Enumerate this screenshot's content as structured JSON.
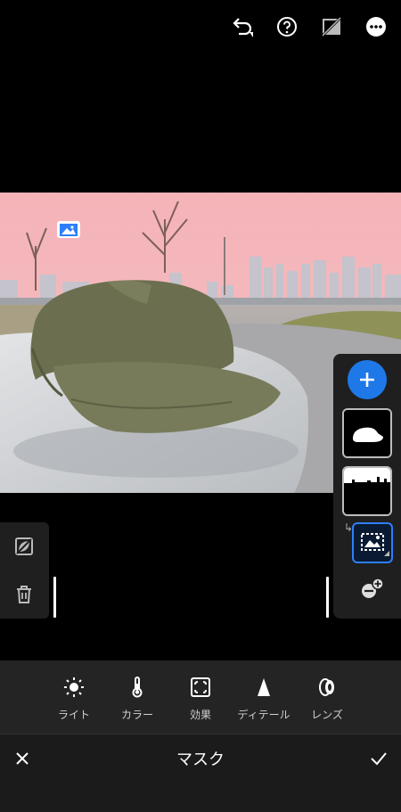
{
  "top_bar": {
    "icons": [
      "undo-icon",
      "help-icon",
      "compare-off-icon",
      "more-icon"
    ]
  },
  "photo": {
    "description_icon": "image-icon"
  },
  "left_panel": {
    "icons": [
      "invert-mask-icon",
      "trash-icon"
    ]
  },
  "right_panel": {
    "add_icon": "plus-icon",
    "masks": [
      "subject-mask-thumbnail",
      "sky-mask-thumbnail",
      "image-mask-thumbnail"
    ],
    "remove_icon": "subtract-icon"
  },
  "toolbar": {
    "items": [
      {
        "label": "ライト",
        "icon": "sun-icon"
      },
      {
        "label": "カラー",
        "icon": "thermometer-icon"
      },
      {
        "label": "効果",
        "icon": "vignette-icon"
      },
      {
        "label": "ディテール",
        "icon": "triangle-icon"
      },
      {
        "label": "レンズ",
        "icon": "lens-icon"
      }
    ]
  },
  "bottom_bar": {
    "title": "マスク",
    "cancel_icon": "close-icon",
    "confirm_icon": "check-icon"
  },
  "colors": {
    "accent": "#1e78e8",
    "sky": "#f7b7bd",
    "hat": "#6f7352"
  }
}
